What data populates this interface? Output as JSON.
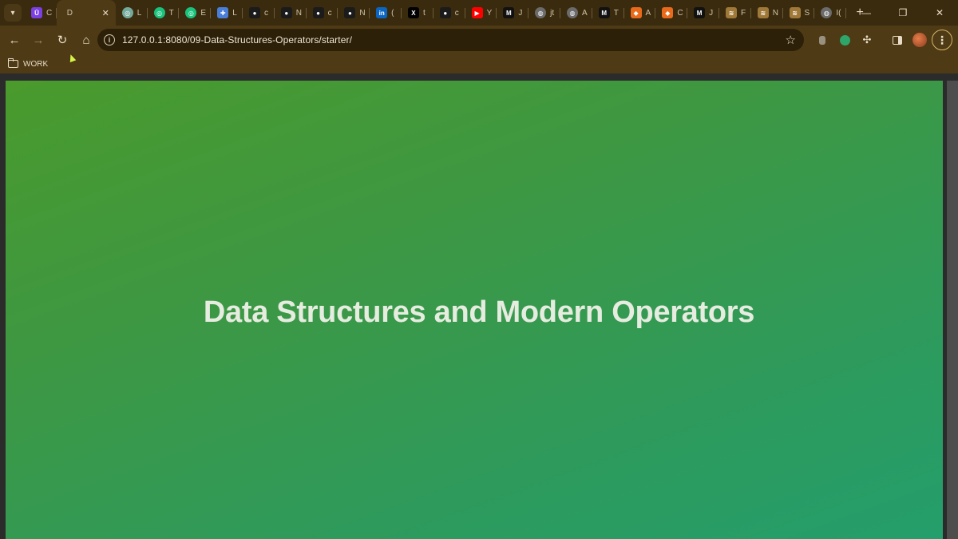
{
  "browser": {
    "active_tab": {
      "letter": "D",
      "close": "✕"
    },
    "tabs": [
      {
        "icon": "udemy-icon",
        "color": "#7b3fe4",
        "glyph": "Ū",
        "letter": "C"
      },
      {
        "icon": "chatgpt-icon",
        "color": "#74aa9c",
        "glyph": "◎",
        "letter": "L"
      },
      {
        "icon": "chatgpt-icon",
        "color": "#19c37d",
        "glyph": "◎",
        "letter": "T"
      },
      {
        "icon": "chatgpt-icon",
        "color": "#19c37d",
        "glyph": "◎",
        "letter": "E"
      },
      {
        "icon": "diagram-icon",
        "color": "#4a7fd9",
        "glyph": "✚",
        "letter": "L"
      },
      {
        "icon": "github-icon",
        "color": "#1b1b1b",
        "glyph": "●",
        "letter": "c"
      },
      {
        "icon": "github-icon",
        "color": "#1b1b1b",
        "glyph": "●",
        "letter": "N"
      },
      {
        "icon": "github-icon",
        "color": "#1b1b1b",
        "glyph": "●",
        "letter": "c"
      },
      {
        "icon": "github-icon",
        "color": "#1b1b1b",
        "glyph": "●",
        "letter": "N"
      },
      {
        "icon": "linkedin-icon",
        "color": "#0a66c2",
        "glyph": "in",
        "letter": "("
      },
      {
        "icon": "x-icon",
        "color": "#000000",
        "glyph": "X",
        "letter": "t"
      },
      {
        "icon": "github-icon",
        "color": "#1b1b1b",
        "glyph": "●",
        "letter": "c"
      },
      {
        "icon": "youtube-icon",
        "color": "#ff0000",
        "glyph": "▶",
        "letter": "Y"
      },
      {
        "icon": "medium-icon",
        "color": "#111111",
        "glyph": "M",
        "letter": "J"
      },
      {
        "icon": "globe-icon",
        "color": "#6b6b6b",
        "glyph": "◍",
        "letter": "jt"
      },
      {
        "icon": "globe-icon",
        "color": "#6b6b6b",
        "glyph": "◍",
        "letter": "A"
      },
      {
        "icon": "medium-icon",
        "color": "#111111",
        "glyph": "M",
        "letter": "T"
      },
      {
        "icon": "box-icon",
        "color": "#e86a1a",
        "glyph": "◆",
        "letter": "A"
      },
      {
        "icon": "box-icon",
        "color": "#e86a1a",
        "glyph": "◆",
        "letter": "C"
      },
      {
        "icon": "medium-icon",
        "color": "#111111",
        "glyph": "M",
        "letter": "J"
      },
      {
        "icon": "stack-icon",
        "color": "#a07838",
        "glyph": "≋",
        "letter": "F"
      },
      {
        "icon": "stack-icon",
        "color": "#a07838",
        "glyph": "≋",
        "letter": "N"
      },
      {
        "icon": "stack-icon",
        "color": "#a07838",
        "glyph": "≋",
        "letter": "S"
      },
      {
        "icon": "globe-icon",
        "color": "#6b6b6b",
        "glyph": "◍",
        "letter": "I("
      }
    ],
    "new_tab": "+",
    "window": {
      "minimize": "—",
      "maximize": "❐",
      "close": "✕"
    },
    "toolbar": {
      "back": "←",
      "forward": "→",
      "reload": "↻",
      "home": "⌂",
      "url": "127.0.0.1:8080/09-Data-Structures-Operators/starter/",
      "info": "i",
      "star": "☆",
      "menu": "⋮"
    },
    "bookmarks": [
      {
        "label": "WORK",
        "icon": "folder-icon"
      }
    ]
  },
  "page": {
    "heading": "Data Structures and Modern Operators",
    "gradient": [
      "#4a9a2c",
      "#249e6c"
    ]
  }
}
